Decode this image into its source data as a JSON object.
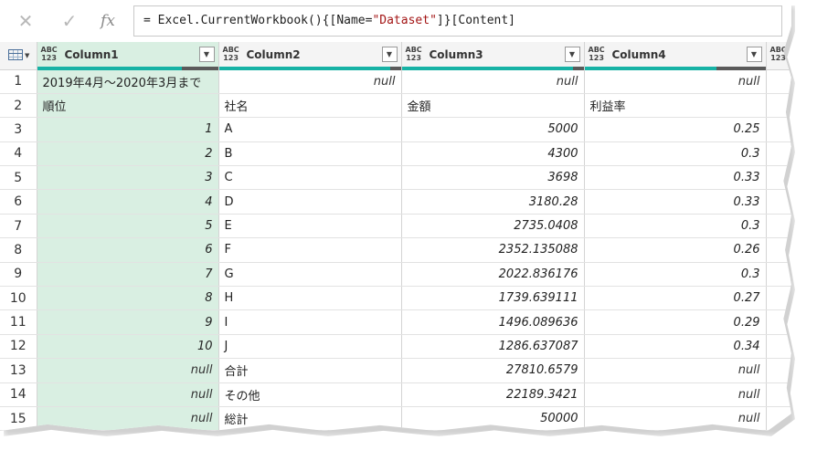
{
  "formula_bar": {
    "cancel_icon": "close-icon",
    "confirm_icon": "check-icon",
    "fx_label": "fx",
    "formula_prefix": "= Excel.CurrentWorkbook(){[Name=",
    "formula_string": "\"Dataset\"",
    "formula_suffix": "]}[Content]"
  },
  "columns": [
    {
      "type": "ABC\n123",
      "name": "Column1"
    },
    {
      "type": "ABC\n123",
      "name": "Column2"
    },
    {
      "type": "ABC\n123",
      "name": "Column3"
    },
    {
      "type": "ABC\n123",
      "name": "Column4"
    },
    {
      "type": "ABC\n123",
      "name": ""
    }
  ],
  "rows": [
    {
      "n": "1",
      "c1": "2019年4月～2020年3月まで",
      "c2": "null",
      "c3": "null",
      "c4": "null"
    },
    {
      "n": "2",
      "c1": "順位",
      "c2": "社名",
      "c3": "金額",
      "c4": "利益率"
    },
    {
      "n": "3",
      "c1": "1",
      "c2": "A",
      "c3": "5000",
      "c4": "0.25"
    },
    {
      "n": "4",
      "c1": "2",
      "c2": "B",
      "c3": "4300",
      "c4": "0.3"
    },
    {
      "n": "5",
      "c1": "3",
      "c2": "C",
      "c3": "3698",
      "c4": "0.33"
    },
    {
      "n": "6",
      "c1": "4",
      "c2": "D",
      "c3": "3180.28",
      "c4": "0.33"
    },
    {
      "n": "7",
      "c1": "5",
      "c2": "E",
      "c3": "2735.0408",
      "c4": "0.3"
    },
    {
      "n": "8",
      "c1": "6",
      "c2": "F",
      "c3": "2352.135088",
      "c4": "0.26"
    },
    {
      "n": "9",
      "c1": "7",
      "c2": "G",
      "c3": "2022.836176",
      "c4": "0.3"
    },
    {
      "n": "10",
      "c1": "8",
      "c2": "H",
      "c3": "1739.639111",
      "c4": "0.27"
    },
    {
      "n": "11",
      "c1": "9",
      "c2": "I",
      "c3": "1496.089636",
      "c4": "0.29"
    },
    {
      "n": "12",
      "c1": "10",
      "c2": "J",
      "c3": "1286.637087",
      "c4": "0.34"
    },
    {
      "n": "13",
      "c1": "null",
      "c2": "合計",
      "c3": "27810.6579",
      "c4": "null"
    },
    {
      "n": "14",
      "c1": "null",
      "c2": "その他",
      "c3": "22189.3421",
      "c4": "null"
    },
    {
      "n": "15",
      "c1": "null",
      "c2": "総計",
      "c3": "50000",
      "c4": "null"
    }
  ],
  "colors": {
    "selected_column": "#d9efe2",
    "quality_valid": "#17b2a5",
    "quality_error": "#5a5a5a"
  }
}
